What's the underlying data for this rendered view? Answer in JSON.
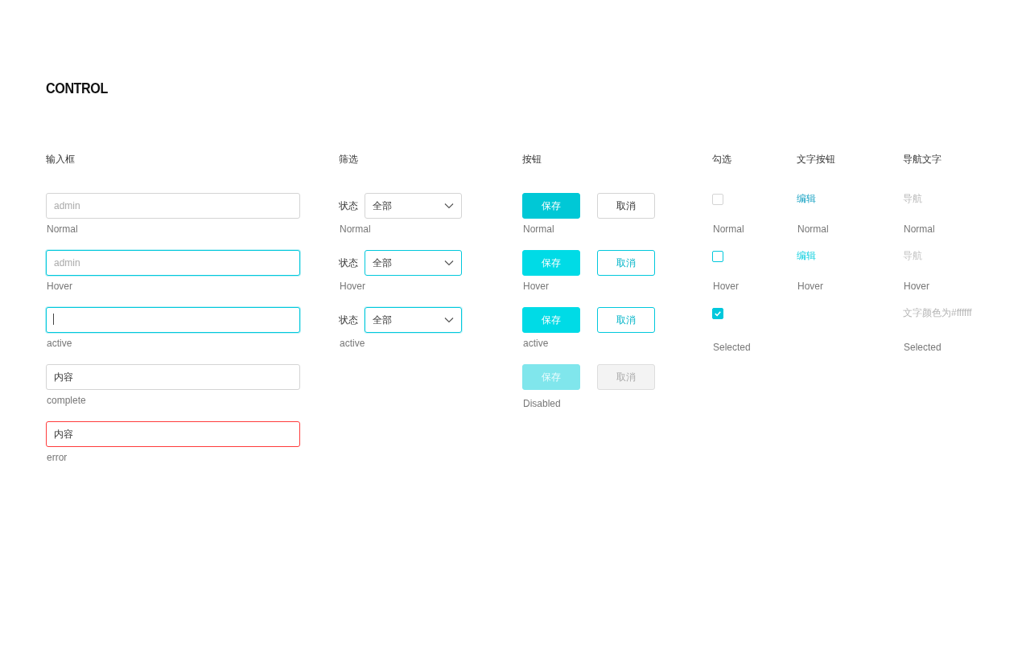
{
  "title": "CONTROL",
  "sections": [
    {
      "kind": "input",
      "heading": "输入框",
      "items": [
        {
          "kind": "idle",
          "placeholder": "admin",
          "caption": "Normal"
        },
        {
          "kind": "hovered",
          "placeholder": "admin",
          "caption": "Hover"
        },
        {
          "kind": "focused",
          "caption": "active"
        },
        {
          "kind": "filled",
          "value": "内容",
          "caption": "complete"
        },
        {
          "kind": "invalid",
          "value": "内容",
          "caption": "error"
        }
      ]
    },
    {
      "kind": "filter",
      "heading": "筛选",
      "items": [
        {
          "kind": "idle",
          "label": "状态",
          "value": "全部",
          "caption": "Normal"
        },
        {
          "kind": "hovered",
          "label": "状态",
          "value": "全部",
          "caption": "Hover"
        },
        {
          "kind": "focused",
          "label": "状态",
          "value": "全部",
          "caption": "active"
        }
      ]
    },
    {
      "kind": "button",
      "heading": "按钮",
      "items": [
        {
          "kind": "idle",
          "primary": "保存",
          "secondary": "取消",
          "caption": "Normal"
        },
        {
          "kind": "hovered",
          "primary": "保存",
          "secondary": "取消",
          "caption": "Hover"
        },
        {
          "kind": "pressed",
          "primary": "保存",
          "secondary": "取消",
          "caption": "active"
        },
        {
          "kind": "off",
          "primary": "保存",
          "secondary": "取消",
          "caption": "Disabled"
        }
      ]
    },
    {
      "kind": "checkbox",
      "heading": "勾选",
      "items": [
        {
          "kind": "idle",
          "checked": false,
          "caption": "Normal"
        },
        {
          "kind": "hovered",
          "checked": false,
          "caption": "Hover"
        },
        {
          "kind": "idle",
          "checked": true,
          "caption": "Selected"
        }
      ]
    },
    {
      "kind": "text_button",
      "heading": "文字按钮",
      "items": [
        {
          "kind": "idle",
          "label": "编辑",
          "caption": "Normal"
        },
        {
          "kind": "hovered",
          "label": "编辑",
          "caption": "Hover"
        }
      ]
    },
    {
      "kind": "nav",
      "heading": "导航文字",
      "items": [
        {
          "kind": "idle",
          "label": "导航",
          "caption": "Normal"
        },
        {
          "kind": "hovered",
          "label": "导航",
          "caption": "Hover"
        },
        {
          "kind": "current",
          "label": "文字颜色为#ffffff",
          "caption": "Selected"
        }
      ]
    }
  ]
}
